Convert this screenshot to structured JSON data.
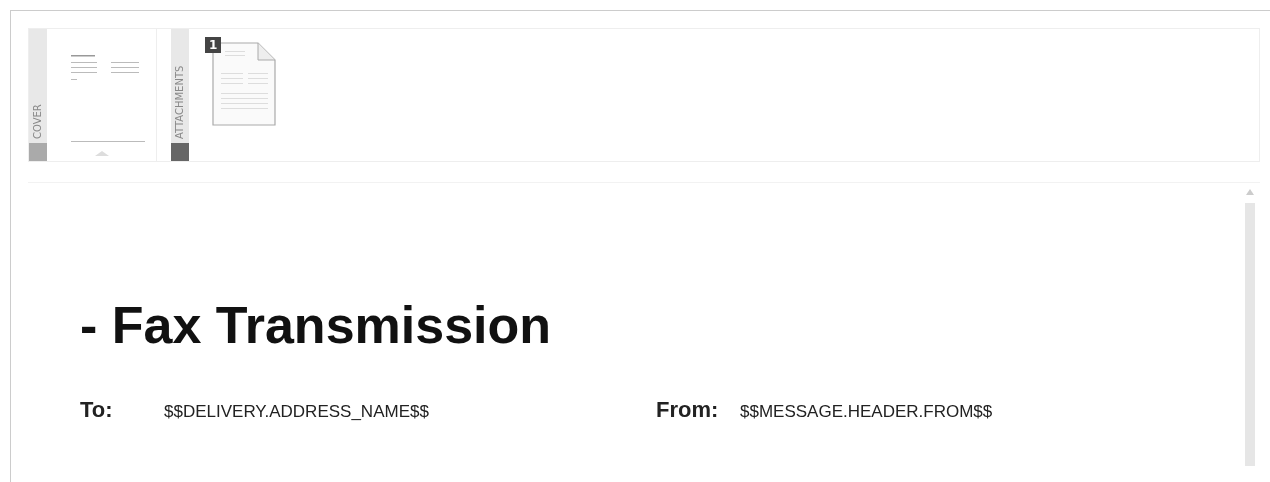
{
  "sections": [
    {
      "label": "COVER",
      "kind": "cover",
      "selected": false
    },
    {
      "label": "ATTACHMENTS",
      "kind": "attachments",
      "selected": true,
      "badge": "1"
    }
  ],
  "document": {
    "title": "- Fax Transmission",
    "fields": [
      {
        "label": "To:",
        "value": "$$DELIVERY.ADDRESS_NAME$$"
      },
      {
        "label": "From:",
        "value": "$$MESSAGE.HEADER.FROM$$"
      }
    ]
  }
}
